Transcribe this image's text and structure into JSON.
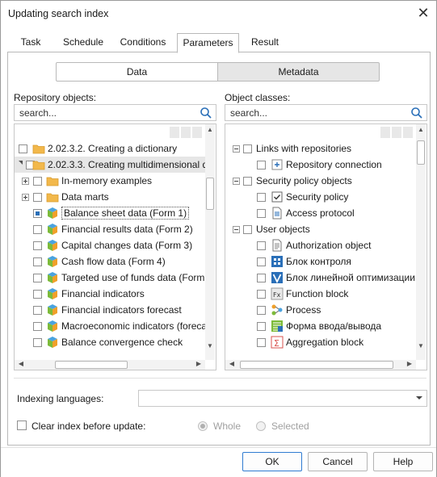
{
  "window": {
    "title": "Updating search index",
    "close_glyph": "✕"
  },
  "tabs": [
    {
      "label": "Task",
      "active": false
    },
    {
      "label": "Schedule",
      "active": false
    },
    {
      "label": "Conditions",
      "active": false
    },
    {
      "label": "Parameters",
      "active": true
    },
    {
      "label": "Result",
      "active": false
    }
  ],
  "segments": {
    "data": "Data",
    "metadata": "Metadata",
    "selected": "Data"
  },
  "left": {
    "label": "Repository objects:",
    "search_placeholder": "search...",
    "items": [
      {
        "text": "2.02.3.2. Creating a dictionary",
        "icon": "folder-icon",
        "checkbox": "empty",
        "level": 0
      },
      {
        "text": "2.02.3.3. Creating multidimensional d",
        "icon": "folder-icon",
        "checkbox": "empty",
        "level": 0,
        "expanded": true,
        "highlighted": true
      },
      {
        "text": "In-memory examples",
        "icon": "folder-icon",
        "checkbox": "empty",
        "level": 1,
        "expander": "plus"
      },
      {
        "text": "Data marts",
        "icon": "folder-icon",
        "checkbox": "empty",
        "level": 1,
        "expander": "plus"
      },
      {
        "text": "Balance sheet data (Form 1)",
        "icon": "cube-icon",
        "checkbox": "partial",
        "level": 1,
        "selected": true
      },
      {
        "text": "Financial results data (Form 2)",
        "icon": "cube-icon",
        "checkbox": "empty",
        "level": 1
      },
      {
        "text": "Capital changes data (Form 3)",
        "icon": "cube-icon",
        "checkbox": "empty",
        "level": 1
      },
      {
        "text": "Cash flow data (Form 4)",
        "icon": "cube-icon",
        "checkbox": "empty",
        "level": 1
      },
      {
        "text": "Targeted use of funds data (Form",
        "icon": "cube-icon",
        "checkbox": "empty",
        "level": 1
      },
      {
        "text": "Financial indicators",
        "icon": "cube-icon",
        "checkbox": "empty",
        "level": 1
      },
      {
        "text": "Financial indicators forecast",
        "icon": "cube-icon",
        "checkbox": "empty",
        "level": 1
      },
      {
        "text": "Macroeconomic indicators (foreca",
        "icon": "cube-icon",
        "checkbox": "empty",
        "level": 1
      },
      {
        "text": "Balance convergence check",
        "icon": "cube-icon",
        "checkbox": "empty",
        "level": 1
      }
    ]
  },
  "right": {
    "label": "Object classes:",
    "search_placeholder": "search...",
    "items": [
      {
        "text": "Links with repositories",
        "icon": "",
        "checkbox": "empty",
        "level": 0,
        "expander": "minus"
      },
      {
        "text": "Repository connection",
        "icon": "repository-connection-icon",
        "checkbox": "empty",
        "level": 1
      },
      {
        "text": "Security policy objects",
        "icon": "",
        "checkbox": "empty",
        "level": 0,
        "expander": "minus"
      },
      {
        "text": "Security policy",
        "icon": "security-policy-icon",
        "checkbox": "empty",
        "level": 1
      },
      {
        "text": "Access protocol",
        "icon": "access-protocol-icon",
        "checkbox": "empty",
        "level": 1
      },
      {
        "text": "User objects",
        "icon": "",
        "checkbox": "empty",
        "level": 0,
        "expander": "minus"
      },
      {
        "text": "Authorization object",
        "icon": "document-icon",
        "checkbox": "empty",
        "level": 1
      },
      {
        "text": "Блок контроля",
        "icon": "control-block-icon",
        "checkbox": "empty",
        "level": 1
      },
      {
        "text": "Блок линейной оптимизации",
        "icon": "linear-optimization-icon",
        "checkbox": "empty",
        "level": 1
      },
      {
        "text": "Function block",
        "icon": "function-block-icon",
        "checkbox": "empty",
        "level": 1
      },
      {
        "text": "Process",
        "icon": "process-icon",
        "checkbox": "empty",
        "level": 1
      },
      {
        "text": "Форма ввода/вывода",
        "icon": "input-output-form-icon",
        "checkbox": "empty",
        "level": 1
      },
      {
        "text": "Aggregation block",
        "icon": "aggregation-block-icon",
        "checkbox": "empty",
        "level": 1
      }
    ]
  },
  "indexing": {
    "label": "Indexing languages:",
    "value": ""
  },
  "clear_index": {
    "label": "Clear index before update:",
    "checked": false,
    "options": [
      {
        "label": "Whole",
        "selected": true
      },
      {
        "label": "Selected",
        "selected": false
      }
    ]
  },
  "buttons": {
    "ok": "OK",
    "cancel": "Cancel",
    "help": "Help"
  },
  "colors": {
    "accent": "#2f7bd1",
    "folder": "#f2b84b",
    "highlight_row": "#e6e6e6",
    "partial_check": "#2a6fb8"
  }
}
